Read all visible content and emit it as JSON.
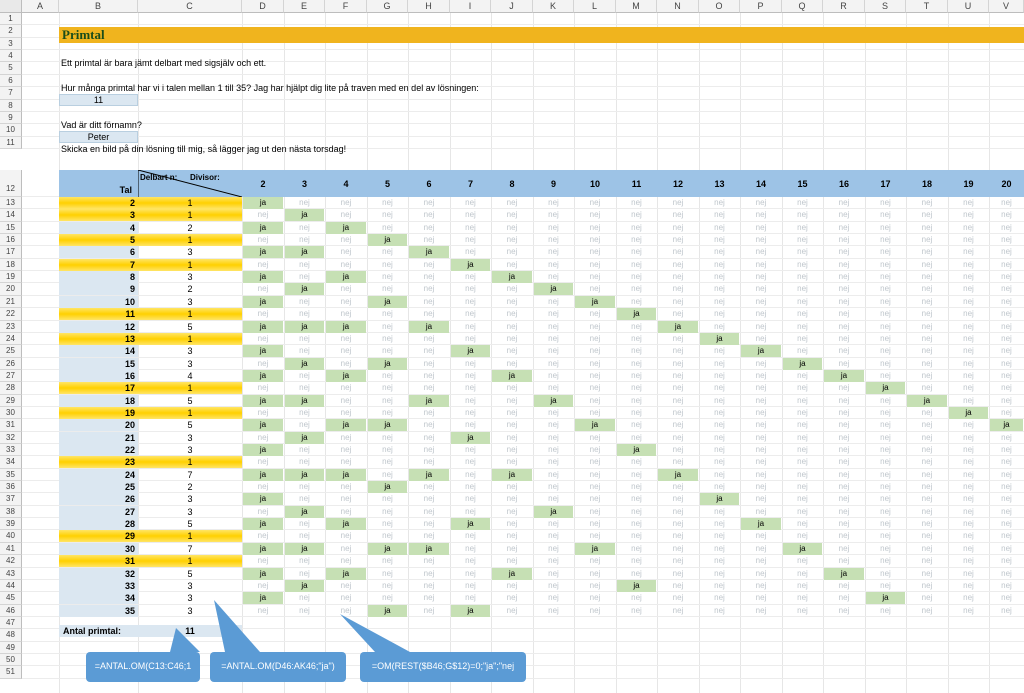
{
  "columns": [
    "A",
    "B",
    "C",
    "D",
    "E",
    "F",
    "G",
    "H",
    "I",
    "J",
    "K",
    "L",
    "M",
    "N",
    "O",
    "P",
    "Q",
    "R",
    "S",
    "T",
    "U",
    "V"
  ],
  "rows": [
    "1",
    "2",
    "3",
    "4",
    "5",
    "6",
    "7",
    "8",
    "9",
    "10",
    "11",
    "12",
    "13",
    "14",
    "15",
    "16",
    "17",
    "18",
    "19",
    "20",
    "21",
    "22",
    "23",
    "24",
    "25",
    "26",
    "27",
    "28",
    "29",
    "30",
    "31",
    "32",
    "33",
    "34",
    "35",
    "36",
    "37",
    "38",
    "39",
    "40",
    "41",
    "42",
    "43",
    "44",
    "45",
    "46",
    "47",
    "48",
    "49",
    "50",
    "51"
  ],
  "title": "Primtal",
  "line3": "Ett primtal är bara jämt delbart med sigsjälv och ett.",
  "line5": "Hur många primtal har vi i talen mellan 1 till 35? Jag har hjälpt dig lite på traven med en del av lösningen:",
  "input6": "11",
  "line8": "Vad är ditt förnamn?",
  "input9": "Peter",
  "line10": "Skicka en bild på din lösning till mig, så lägger jag ut den nästa torsdag!",
  "header": {
    "tal": "Tal",
    "delbart": "Delbart n:",
    "divisor": "Divisor:",
    "divisors": [
      "2",
      "3",
      "4",
      "5",
      "6",
      "7",
      "8",
      "9",
      "10",
      "11",
      "12",
      "13",
      "14",
      "15",
      "16",
      "17",
      "18",
      "19",
      "20"
    ]
  },
  "yes_text": "ja",
  "no_text": "nej",
  "table_rows": [
    {
      "tal": "2",
      "delbart": "1",
      "prime": true
    },
    {
      "tal": "3",
      "delbart": "1",
      "prime": true
    },
    {
      "tal": "4",
      "delbart": "2",
      "prime": false
    },
    {
      "tal": "5",
      "delbart": "1",
      "prime": true
    },
    {
      "tal": "6",
      "delbart": "3",
      "prime": false
    },
    {
      "tal": "7",
      "delbart": "1",
      "prime": true
    },
    {
      "tal": "8",
      "delbart": "3",
      "prime": false
    },
    {
      "tal": "9",
      "delbart": "2",
      "prime": false
    },
    {
      "tal": "10",
      "delbart": "3",
      "prime": false
    },
    {
      "tal": "11",
      "delbart": "1",
      "prime": true
    },
    {
      "tal": "12",
      "delbart": "5",
      "prime": false
    },
    {
      "tal": "13",
      "delbart": "1",
      "prime": true
    },
    {
      "tal": "14",
      "delbart": "3",
      "prime": false
    },
    {
      "tal": "15",
      "delbart": "3",
      "prime": false
    },
    {
      "tal": "16",
      "delbart": "4",
      "prime": false
    },
    {
      "tal": "17",
      "delbart": "1",
      "prime": true
    },
    {
      "tal": "18",
      "delbart": "5",
      "prime": false
    },
    {
      "tal": "19",
      "delbart": "1",
      "prime": true
    },
    {
      "tal": "20",
      "delbart": "5",
      "prime": false
    },
    {
      "tal": "21",
      "delbart": "3",
      "prime": false
    },
    {
      "tal": "22",
      "delbart": "3",
      "prime": false
    },
    {
      "tal": "23",
      "delbart": "1",
      "prime": true
    },
    {
      "tal": "24",
      "delbart": "7",
      "prime": false
    },
    {
      "tal": "25",
      "delbart": "2",
      "prime": false
    },
    {
      "tal": "26",
      "delbart": "3",
      "prime": false
    },
    {
      "tal": "27",
      "delbart": "3",
      "prime": false
    },
    {
      "tal": "28",
      "delbart": "5",
      "prime": false
    },
    {
      "tal": "29",
      "delbart": "1",
      "prime": true
    },
    {
      "tal": "30",
      "delbart": "7",
      "prime": false
    },
    {
      "tal": "31",
      "delbart": "1",
      "prime": true
    },
    {
      "tal": "32",
      "delbart": "5",
      "prime": false
    },
    {
      "tal": "33",
      "delbart": "3",
      "prime": false
    },
    {
      "tal": "34",
      "delbart": "3",
      "prime": false
    },
    {
      "tal": "35",
      "delbart": "3",
      "prime": false
    }
  ],
  "total_label": "Antal primtal:",
  "total_value": "11",
  "callouts": [
    "=ANTAL.OM(C13:C46;1",
    "=ANTAL.OM(D46:AK46;\"ja\")",
    "=OM(REST($B46;G$12)=0;\"ja\";\"nej"
  ],
  "colors": {
    "title_band": "#f0b41e",
    "header": "#9dc3e6",
    "prime_row": "#ffd700",
    "ja": "#c6e0b4",
    "callout": "#5b9bd5"
  }
}
